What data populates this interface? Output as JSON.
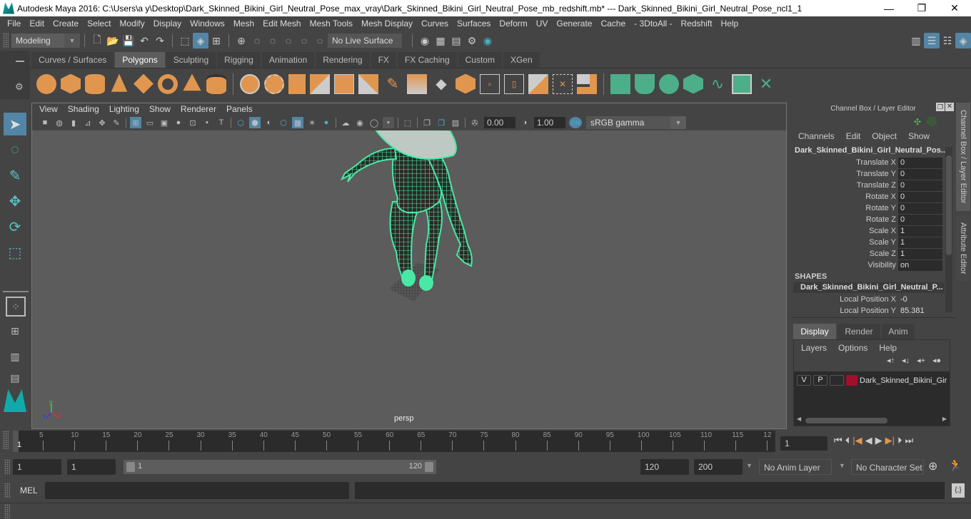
{
  "window": {
    "title": "Autodesk Maya 2016: C:\\Users\\a y\\Desktop\\Dark_Skinned_Bikini_Girl_Neutral_Pose_max_vray\\Dark_Skinned_Bikini_Girl_Neutral_Pose_mb_redshift.mb*   ---   Dark_Skinned_Bikini_Girl_Neutral_Pose_ncl1_1",
    "minimize": "—",
    "maximize": "❐",
    "close": "✕"
  },
  "menubar": [
    "File",
    "Edit",
    "Create",
    "Select",
    "Modify",
    "Display",
    "Windows",
    "Mesh",
    "Edit Mesh",
    "Mesh Tools",
    "Mesh Display",
    "Curves",
    "Surfaces",
    "Deform",
    "UV",
    "Generate",
    "Cache",
    "- 3DtoAll -",
    "Redshift",
    "Help"
  ],
  "statusline": {
    "mode": "Modeling",
    "live_surface": "No Live Surface"
  },
  "shelf": {
    "tabs": [
      "Curves / Surfaces",
      "Polygons",
      "Sculpting",
      "Rigging",
      "Animation",
      "Rendering",
      "FX",
      "FX Caching",
      "Custom",
      "XGen"
    ],
    "active_tab": "Polygons"
  },
  "viewport": {
    "menu": [
      "View",
      "Shading",
      "Lighting",
      "Show",
      "Renderer",
      "Panels"
    ],
    "exposure": "0.00",
    "gamma": "1.00",
    "color_space": "sRGB gamma",
    "camera_label": "persp",
    "axis": {
      "x": "x",
      "y": "y",
      "z": "z"
    }
  },
  "channel_box": {
    "title": "Channel Box / Layer Editor",
    "menu": [
      "Channels",
      "Edit",
      "Object",
      "Show"
    ],
    "object_name": "Dark_Skinned_Bikini_Girl_Neutral_Pos...",
    "channels": [
      {
        "label": "Translate X",
        "value": "0"
      },
      {
        "label": "Translate Y",
        "value": "0"
      },
      {
        "label": "Translate Z",
        "value": "0"
      },
      {
        "label": "Rotate X",
        "value": "0"
      },
      {
        "label": "Rotate Y",
        "value": "0"
      },
      {
        "label": "Rotate Z",
        "value": "0"
      },
      {
        "label": "Scale X",
        "value": "1"
      },
      {
        "label": "Scale Y",
        "value": "1"
      },
      {
        "label": "Scale Z",
        "value": "1"
      },
      {
        "label": "Visibility",
        "value": "on"
      }
    ],
    "shapes_header": "SHAPES",
    "shape_name": "Dark_Skinned_Bikini_Girl_Neutral_P...",
    "shape_channels": [
      {
        "label": "Local Position X",
        "value": "-0"
      },
      {
        "label": "Local Position Y",
        "value": "85.381"
      }
    ]
  },
  "layer_editor": {
    "tabs": [
      "Display",
      "Render",
      "Anim"
    ],
    "active_tab": "Display",
    "menu": [
      "Layers",
      "Options",
      "Help"
    ],
    "layers": [
      {
        "v": "V",
        "p": "P",
        "color": "#a0102a",
        "name": "Dark_Skinned_Bikini_Gir"
      }
    ]
  },
  "side_tabs": [
    "Channel Box / Layer Editor",
    "Attribute Editor"
  ],
  "timeline": {
    "ticks": [
      "5",
      "10",
      "15",
      "20",
      "25",
      "30",
      "35",
      "40",
      "45",
      "50",
      "55",
      "60",
      "65",
      "70",
      "75",
      "80",
      "85",
      "90",
      "95",
      "100",
      "105",
      "110",
      "115",
      "12"
    ],
    "current_frame_marker": "1",
    "current_frame": "1"
  },
  "range": {
    "start": "1",
    "playback_start": "1",
    "slider_start": "1",
    "slider_end": "120",
    "playback_end": "120",
    "end": "200",
    "anim_layer": "No Anim Layer",
    "character_set": "No Character Set"
  },
  "command_line": {
    "label": "MEL"
  }
}
